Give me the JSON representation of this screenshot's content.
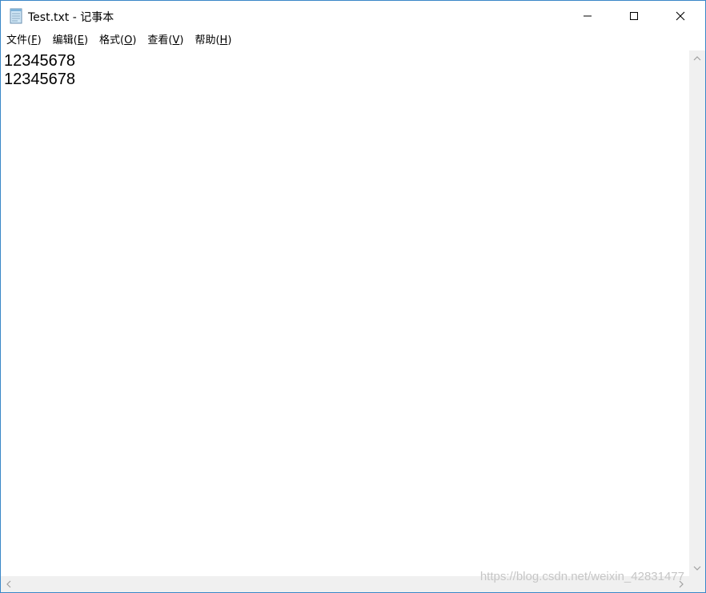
{
  "window": {
    "title": "Test.txt - 记事本",
    "icon": "notepad-icon"
  },
  "caption_buttons": {
    "minimize_icon": "minimize-icon",
    "maximize_icon": "maximize-icon",
    "close_icon": "close-icon"
  },
  "menu": [
    {
      "label": "文件(",
      "accel": "F",
      "tail": ")"
    },
    {
      "label": "编辑(",
      "accel": "E",
      "tail": ")"
    },
    {
      "label": "格式(",
      "accel": "O",
      "tail": ")"
    },
    {
      "label": "查看(",
      "accel": "V",
      "tail": ")"
    },
    {
      "label": "帮助(",
      "accel": "H",
      "tail": ")"
    }
  ],
  "editor": {
    "lines": [
      "12345678",
      "12345678"
    ]
  },
  "watermark": "https://blog.csdn.net/weixin_42831477",
  "colors": {
    "border": "#3a87c8",
    "scrollbar": "#f0f0f0",
    "arrow": "#a0a0a0"
  }
}
